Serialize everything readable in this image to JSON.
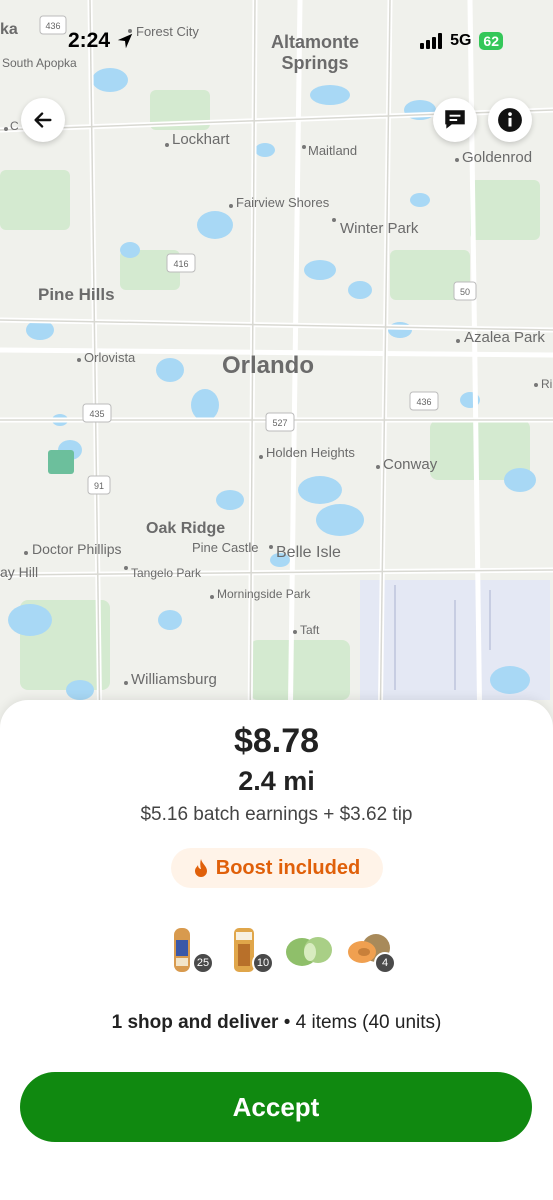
{
  "status_bar": {
    "time": "2:24",
    "network": "5G",
    "battery": "62"
  },
  "map": {
    "labels": {
      "ka": "ka",
      "forest_city": "Forest City",
      "south_apopka": "South Apopka",
      "altamonte": "Altamonte",
      "springs": "Springs",
      "lockhart": "Lockhart",
      "maitland": "Maitland",
      "goldenrod": "Goldenrod",
      "fairview_shores": "Fairview Shores",
      "winter_park": "Winter Park",
      "pine_hills": "Pine Hills",
      "azalea_park": "Azalea Park",
      "orlovista": "Orlovista",
      "orlando": "Orlando",
      "holden_heights": "Holden Heights",
      "conway": "Conway",
      "oak_ridge": "Oak Ridge",
      "doctor_phillips": "Doctor Phillips",
      "pine_castle": "Pine Castle",
      "belle_isle": "Belle Isle",
      "bay_hill": "ay Hill",
      "tangelo_park": "Tangelo Park",
      "morningside_park": "Morningside Park",
      "taft": "Taft",
      "williamsburg": "Williamsburg",
      "left_edge": "C",
      "right_edge": "Ri"
    },
    "shields": {
      "r436_top": "436",
      "r416": "416",
      "r50": "50",
      "r436": "436",
      "r435": "435",
      "r527": "527",
      "r91": "91"
    }
  },
  "offer": {
    "price": "$8.78",
    "distance": "2.4 mi",
    "breakdown": "$5.16 batch earnings + $3.62 tip",
    "boost_label": "Boost included",
    "items": [
      {
        "name": "bread-loaf",
        "qty": "25"
      },
      {
        "name": "bread-loaf-packaged",
        "qty": "10"
      },
      {
        "name": "cabbage",
        "qty": ""
      },
      {
        "name": "cantaloupe",
        "qty": "4"
      }
    ],
    "summary_bold": "1 shop and deliver",
    "summary_rest": " • 4 items (40 units)",
    "accept_label": "Accept"
  },
  "colors": {
    "accent": "#108910",
    "boost": "#e0600a",
    "water": "#a8d8f5",
    "park": "#cfe8c6"
  }
}
